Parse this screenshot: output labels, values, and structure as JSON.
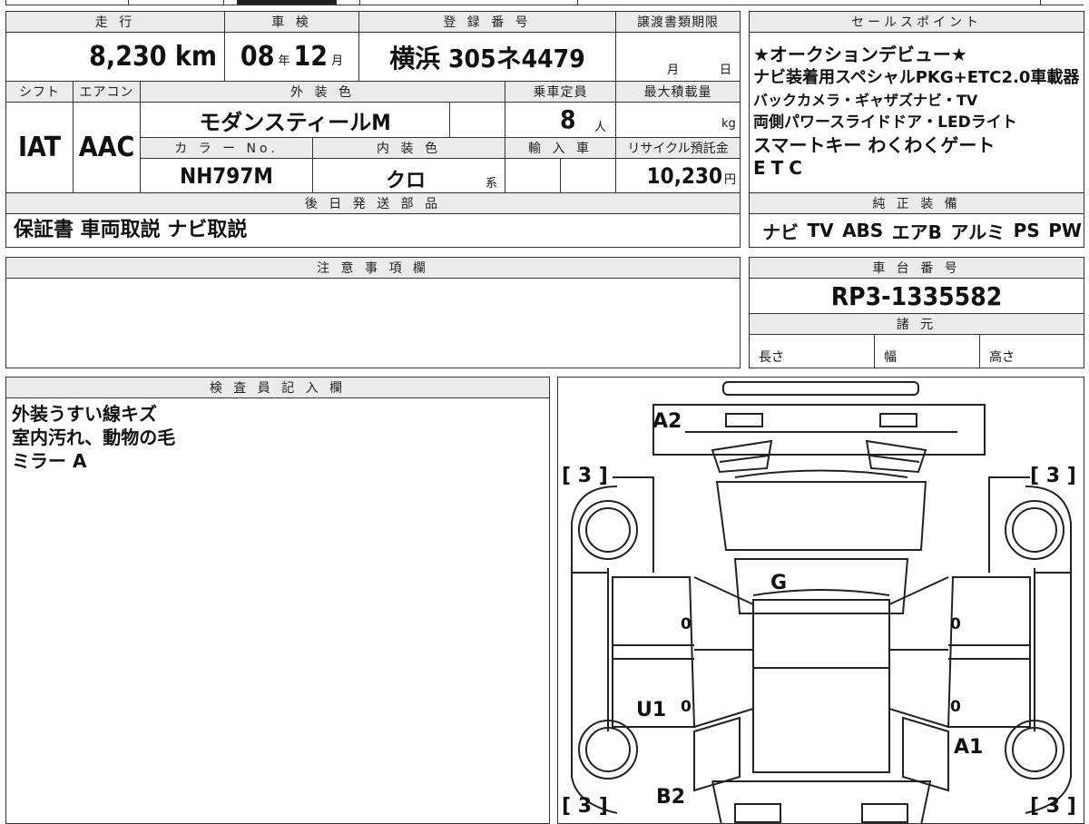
{
  "top_strip": [
    "",
    "",
    "",
    "",
    "",
    ""
  ],
  "mileage": {
    "label": "走 行",
    "value": "8,230",
    "unit": "km"
  },
  "inspection": {
    "label": "車 検",
    "year": "08",
    "year_unit": "年",
    "month": "12",
    "month_unit": "月"
  },
  "registration": {
    "label": "登 録 番 号",
    "value": "横浜 305ネ4479"
  },
  "transfer_deadline": {
    "label": "譲渡書類期限",
    "month_unit": "月",
    "day_unit": "日"
  },
  "shift": {
    "label": "シフト",
    "value": "IAT"
  },
  "aircon": {
    "label": "エアコン",
    "value": "AAC"
  },
  "exterior_color": {
    "label": "外 装 色",
    "value": "モダンスティールM"
  },
  "capacity": {
    "label": "乗車定員",
    "value": "8",
    "unit": "人"
  },
  "max_load": {
    "label": "最大積載量",
    "unit": "kg"
  },
  "color_no": {
    "label": "カ ラ ー No.",
    "value": "NH797M"
  },
  "interior_color": {
    "label": "内 装 色",
    "value": "クロ",
    "suffix": "系"
  },
  "imported": {
    "label": "輸 入 車"
  },
  "recycle": {
    "label": "リサイクル預託金",
    "value": "10,230",
    "unit": "円"
  },
  "later_parts": {
    "label": "後 日 発 送 部 品",
    "value": "保証書 車両取説 ナビ取説"
  },
  "sales_points": {
    "label": "セールスポイント",
    "lines": [
      "★オークションデビュー★",
      "ナビ装着用スペシャルPKG+ETC2.0車載器",
      "バックカメラ・ギャザズナビ・TV",
      "両側パワースライドドア・LEDライト",
      "スマートキー わくわくゲート",
      "ETC"
    ]
  },
  "standard_equipment": {
    "label": "純 正 装 備",
    "items": [
      "ナビ",
      "TV",
      "ABS",
      "エアB",
      "アルミ",
      "PS",
      "PW"
    ]
  },
  "notes": {
    "label": "注 意 事 項 欄",
    "value": ""
  },
  "chassis": {
    "label": "車 台 番 号",
    "value": "RP3-1335582"
  },
  "specs": {
    "label": "諸 元",
    "length": "長さ",
    "width": "幅",
    "height": "高さ"
  },
  "inspector": {
    "label": "検 査 員 記 入 欄",
    "lines": [
      "外装うすい線キズ",
      "室内汚れ、動物の毛",
      "ミラー A"
    ]
  },
  "diagram": {
    "marks": {
      "a2": "A2",
      "g": "G",
      "u1": "U1",
      "a1": "A1",
      "b2": "B2"
    },
    "tire_tl": "3",
    "tire_tr": "3",
    "tire_bl": "3",
    "tire_br": "3",
    "zeros": [
      "0",
      "0",
      "0",
      "0"
    ],
    "bracket_open": "[",
    "bracket_close": "]"
  }
}
